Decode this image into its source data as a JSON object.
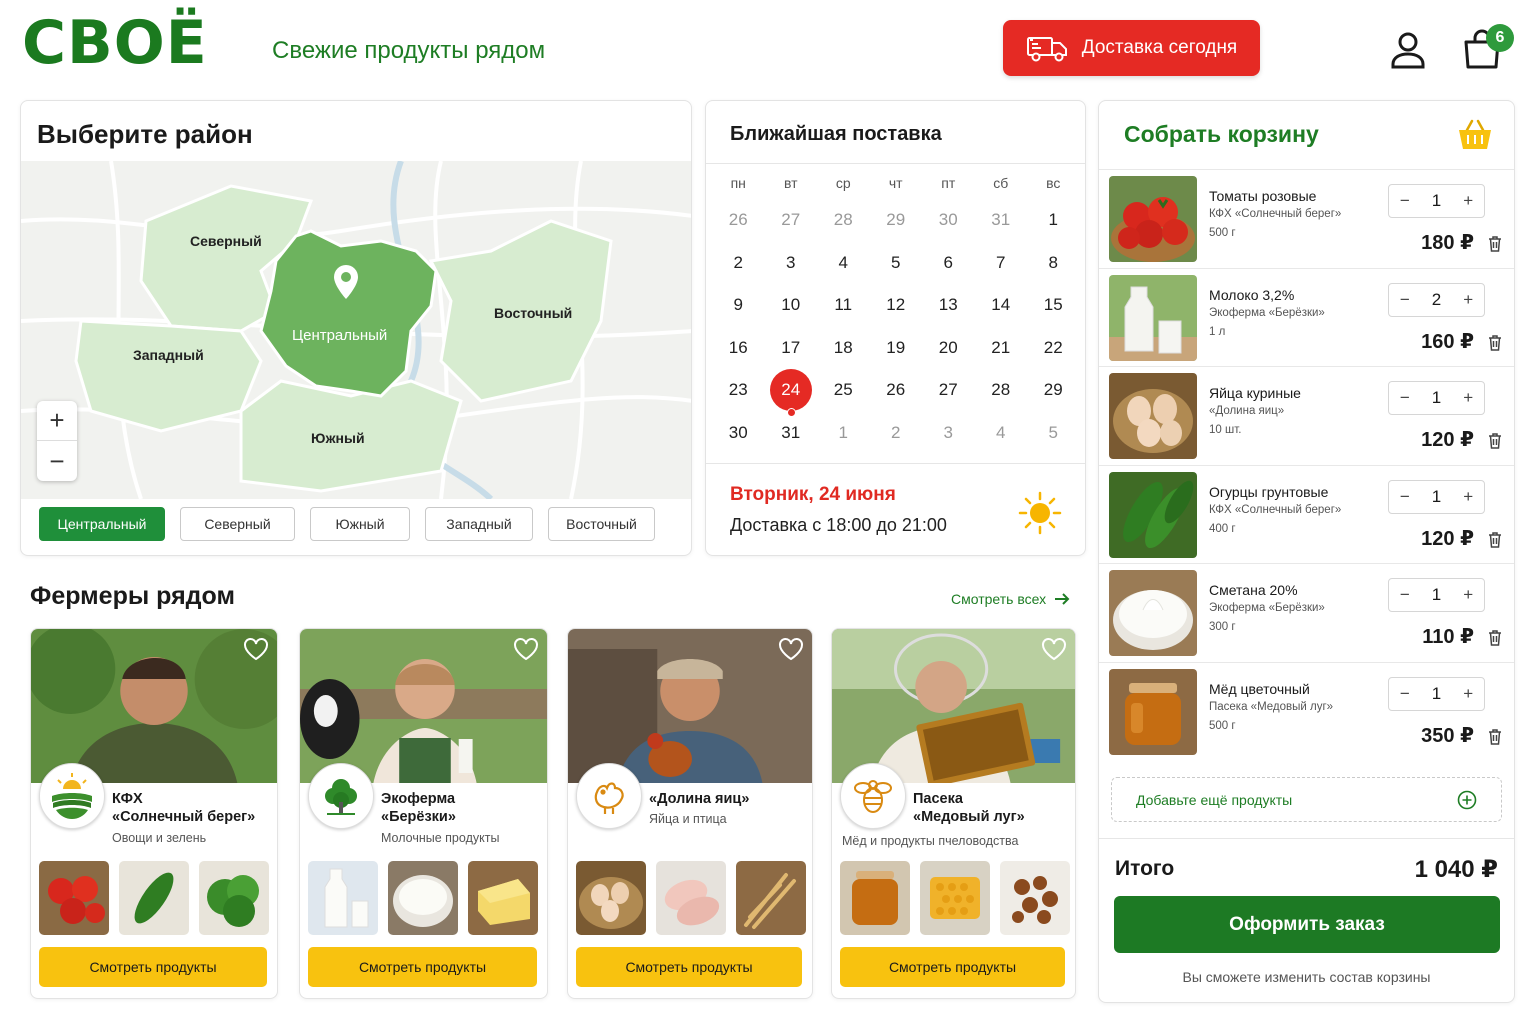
{
  "header": {
    "logo": "СВОЁ",
    "tagline": "Свежие продукты рядом",
    "delivery_label": "Доставка сегодня",
    "cart_count": "6"
  },
  "district": {
    "title": "Выберите район",
    "map_labels": {
      "north": "Северный",
      "center": "Центральный",
      "east": "Восточный",
      "west": "Западный",
      "south": "Южный"
    },
    "zoom_in": "+",
    "zoom_out": "−",
    "chips": [
      "Центральный",
      "Северный",
      "Южный",
      "Западный",
      "Восточный"
    ],
    "selected": "Центральный"
  },
  "calendar": {
    "title": "Ближайшая поставка",
    "weekdays": [
      "пн",
      "вт",
      "ср",
      "чт",
      "пт",
      "сб",
      "вс"
    ],
    "weeks": [
      [
        "26",
        "27",
        "28",
        "29",
        "30",
        "31",
        "1"
      ],
      [
        "2",
        "3",
        "4",
        "5",
        "6",
        "7",
        "8"
      ],
      [
        "9",
        "10",
        "11",
        "12",
        "13",
        "14",
        "15"
      ],
      [
        "16",
        "17",
        "18",
        "19",
        "20",
        "21",
        "22"
      ],
      [
        "23",
        "24",
        "25",
        "26",
        "27",
        "28",
        "29"
      ],
      [
        "30",
        "31",
        "1",
        "2",
        "3",
        "4",
        "5"
      ]
    ],
    "selected_day": "24",
    "delivery_date": "Вторник, 24 июня",
    "delivery_time": "Доставка с 18:00 до 21:00"
  },
  "cart": {
    "title": "Собрать корзину",
    "items": [
      {
        "name": "Томаты розовые",
        "farm": "КФХ «Солнечный берег»",
        "weight": "500 г",
        "qty": "1",
        "price": "180 ₽"
      },
      {
        "name": "Молоко 3,2%",
        "farm": "Экоферма «Берёзки»",
        "weight": "1 л",
        "qty": "2",
        "price": "160 ₽"
      },
      {
        "name": "Яйца куриные",
        "farm": "«Долина яиц»",
        "weight": "10 шт.",
        "qty": "1",
        "price": "120 ₽"
      },
      {
        "name": "Огурцы грунтовые",
        "farm": "КФХ «Солнечный берег»",
        "weight": "400 г",
        "qty": "1",
        "price": "120 ₽"
      },
      {
        "name": "Сметана 20%",
        "farm": "Экоферма «Берёзки»",
        "weight": "300 г",
        "qty": "1",
        "price": "110 ₽"
      },
      {
        "name": "Мёд цветочный",
        "farm": "Пасека «Медовый луг»",
        "weight": "500 г",
        "qty": "1",
        "price": "350 ₽"
      }
    ],
    "minus": "−",
    "plus": "+",
    "add_more": "Добавьте ещё продукты",
    "total_label": "Итого",
    "total_value": "1 040 ₽",
    "order_button": "Оформить заказ",
    "note": "Вы сможете изменить состав корзины"
  },
  "farmers": {
    "title": "Фермеры рядом",
    "see_all": "Смотреть всех",
    "button_label": "Смотреть продукты",
    "items": [
      {
        "name_line1": "КФХ",
        "name_line2": "«Солнечный берег»",
        "category": "Овощи и зелень"
      },
      {
        "name_line1": "Экоферма",
        "name_line2": "«Берёзки»",
        "category": "Молочные продукты"
      },
      {
        "name_line1": "«Долина яиц»",
        "name_line2": "",
        "category": "Яйца и птица"
      },
      {
        "name_line1": "Пасека",
        "name_line2": "«Медовый луг»",
        "category": "Мёд и продукты пчеловодства"
      }
    ]
  },
  "colors": {
    "brand_green": "#1b7a1f",
    "accent_red": "#e52a24",
    "button_yellow": "#f8c20f",
    "map_selected": "#6db35e"
  },
  "icons": [
    "truck-icon",
    "user-icon",
    "shopping-bag-icon",
    "map-pin-icon",
    "sun-icon",
    "basket-icon",
    "trash-icon",
    "plus-circle-icon",
    "arrow-right-icon",
    "heart-icon"
  ]
}
